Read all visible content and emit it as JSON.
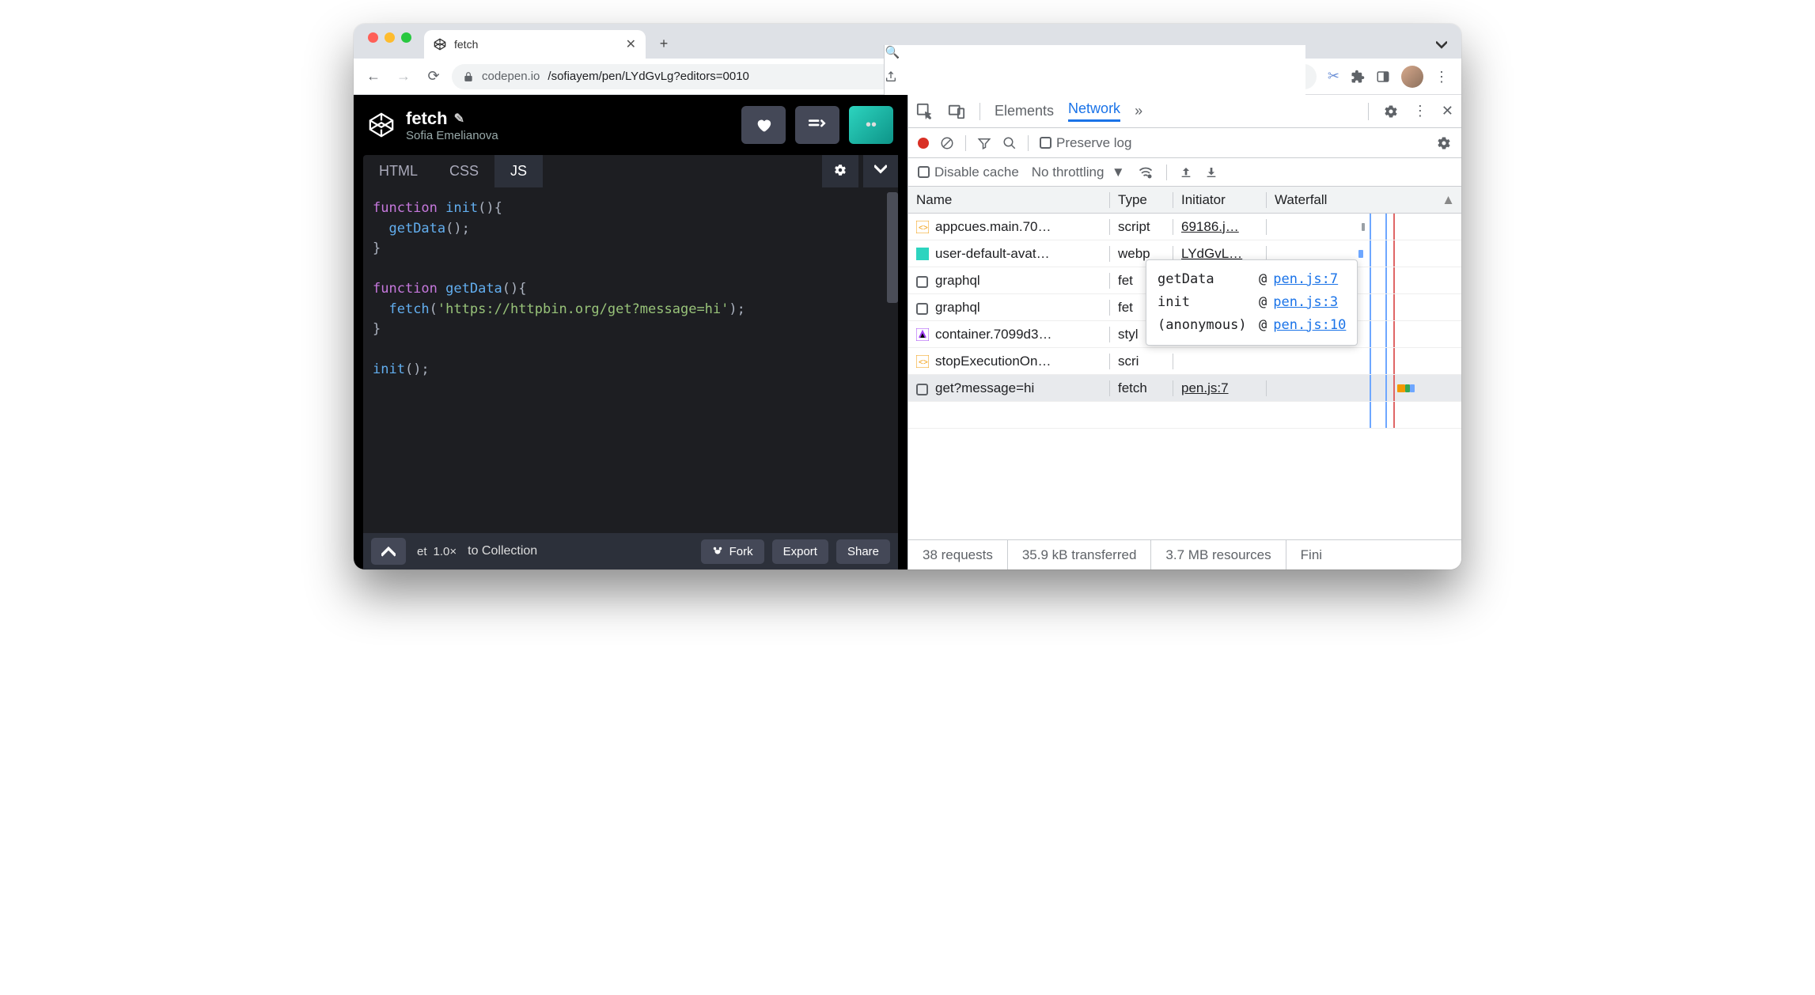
{
  "browser": {
    "tab_title": "fetch",
    "url_host": "codepen.io",
    "url_path": "/sofiayem/pen/LYdGvLg?editors=0010"
  },
  "codepen": {
    "title": "fetch",
    "author": "Sofia Emelianova",
    "tabs": {
      "html": "HTML",
      "css": "CSS",
      "js": "JS"
    },
    "footer": {
      "zoom_partial": "et",
      "zoom_val": "1.0×",
      "to_collection": "to Collection",
      "fork": "Fork",
      "export": "Export",
      "share": "Share"
    },
    "code": {
      "l1a": "function",
      "l1b": "init",
      "l1c": "(){",
      "l2a": "getData",
      "l2b": "();",
      "l3": "}",
      "l4a": "function",
      "l4b": "getData",
      "l4c": "(){",
      "l5a": "fetch",
      "l5b": "(",
      "l5c": "'https://httpbin.org/get?message=hi'",
      "l5d": ");",
      "l6": "}",
      "l7a": "init",
      "l7b": "();"
    }
  },
  "devtools": {
    "tabs": {
      "elements": "Elements",
      "network": "Network"
    },
    "toolbar": {
      "preserve": "Preserve log",
      "disable_cache": "Disable cache",
      "throttling": "No throttling"
    },
    "columns": {
      "name": "Name",
      "type": "Type",
      "initiator": "Initiator",
      "waterfall": "Waterfall"
    },
    "rows": [
      {
        "name": "appcues.main.70…",
        "type": "script",
        "initiator": "69186.j…"
      },
      {
        "name": "user-default-avat…",
        "type": "webp",
        "initiator": "LYdGvL…"
      },
      {
        "name": "graphql",
        "type": "fet",
        "initiator": ""
      },
      {
        "name": "graphql",
        "type": "fet",
        "initiator": ""
      },
      {
        "name": "container.7099d3…",
        "type": "styl",
        "initiator": ""
      },
      {
        "name": "stopExecutionOn…",
        "type": "scri",
        "initiator": ""
      },
      {
        "name": "get?message=hi",
        "type": "fetch",
        "initiator": "pen.js:7"
      }
    ],
    "tooltip": [
      {
        "fn": "getData",
        "loc": "pen.js:7"
      },
      {
        "fn": "init",
        "loc": "pen.js:3"
      },
      {
        "fn": "(anonymous)",
        "loc": "pen.js:10"
      }
    ],
    "at_symbol": "@",
    "status": {
      "requests": "38 requests",
      "transferred": "35.9 kB transferred",
      "resources": "3.7 MB resources",
      "finish": "Fini"
    }
  }
}
